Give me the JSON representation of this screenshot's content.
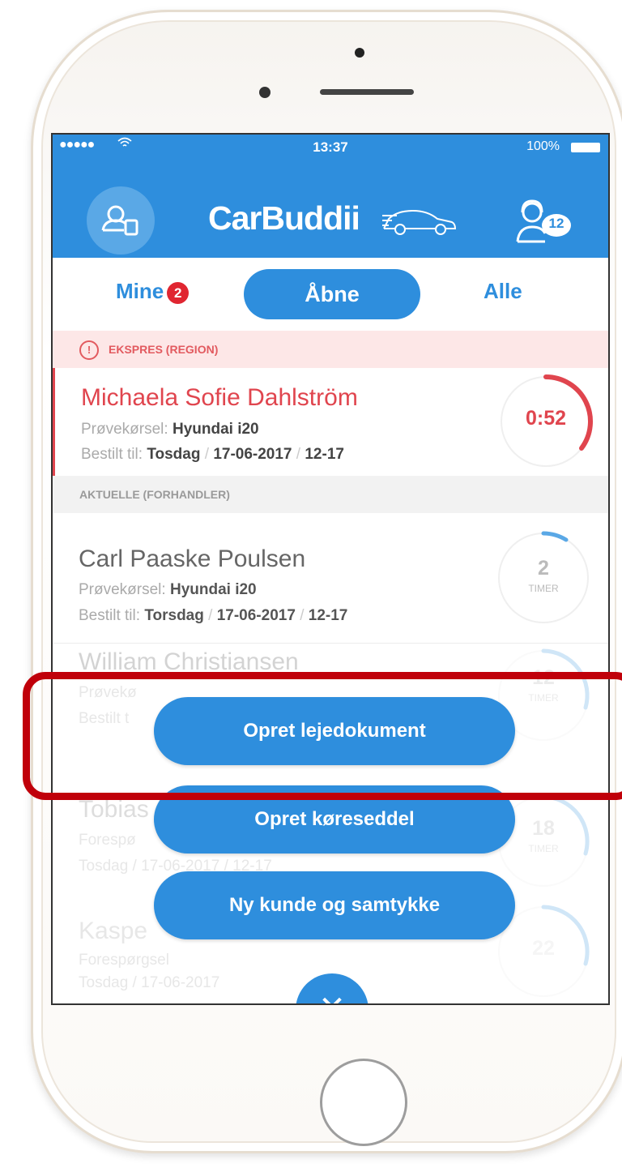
{
  "status_bar": {
    "signal": "●●●●●",
    "time": "13:37",
    "battery": "100%"
  },
  "header": {
    "logo": "CarBuddii",
    "notification_count": "12"
  },
  "tabs": {
    "mine": "Mine",
    "mine_badge": "2",
    "open": "Åbne",
    "all": "Alle"
  },
  "sections": {
    "ekspres": "EKSPRES (REGION)",
    "aktuelle": "AKTUELLE (FORHANDLER)"
  },
  "rows": [
    {
      "name": "Michaela Sofie Dahlström",
      "l1_label": "Prøvekørsel:",
      "l1_value": "Hyundai i20",
      "l2_label": "Bestilt til:",
      "day": "Tosdag",
      "date": "17-06-2017",
      "time": "12-17",
      "timer": "0:52",
      "timer_unit": "",
      "progress": 0.3
    },
    {
      "name": "Carl Paaske Poulsen",
      "l1_label": "Prøvekørsel:",
      "l1_value": "Hyundai i20",
      "l2_label": "Bestilt til:",
      "day": "Torsdag",
      "date": "17-06-2017",
      "time": "12-17",
      "timer": "2",
      "timer_unit": "TIMER",
      "progress": 0.08
    },
    {
      "name": "William Christiansen",
      "l1_label": "Prøvekø",
      "l2_label": "Bestilt t",
      "timer": "12",
      "timer_unit": "TIMER",
      "progress": 0.45
    },
    {
      "name": "Tobias",
      "l1_label": "Forespø",
      "day": "Tosdag",
      "date": "17-06-2017",
      "time": "12-17",
      "timer": "18",
      "timer_unit": "TIMER",
      "progress": 0.45
    },
    {
      "name": "Kaspe",
      "l1_label": "Forespørgsel",
      "day": "Tosdag",
      "date": "17-06-2017",
      "timer": "22",
      "timer_unit": "",
      "progress": 0.45
    }
  ],
  "actions": {
    "lejedokument": "Opret lejedokument",
    "koreseddel": "Opret køreseddel",
    "ny_kunde": "Ny kunde og samtykke",
    "close": "✕"
  },
  "colors": {
    "brand_blue": "#2e8edd",
    "alert_red": "#e0454e",
    "highlight_red": "#c0000a"
  }
}
